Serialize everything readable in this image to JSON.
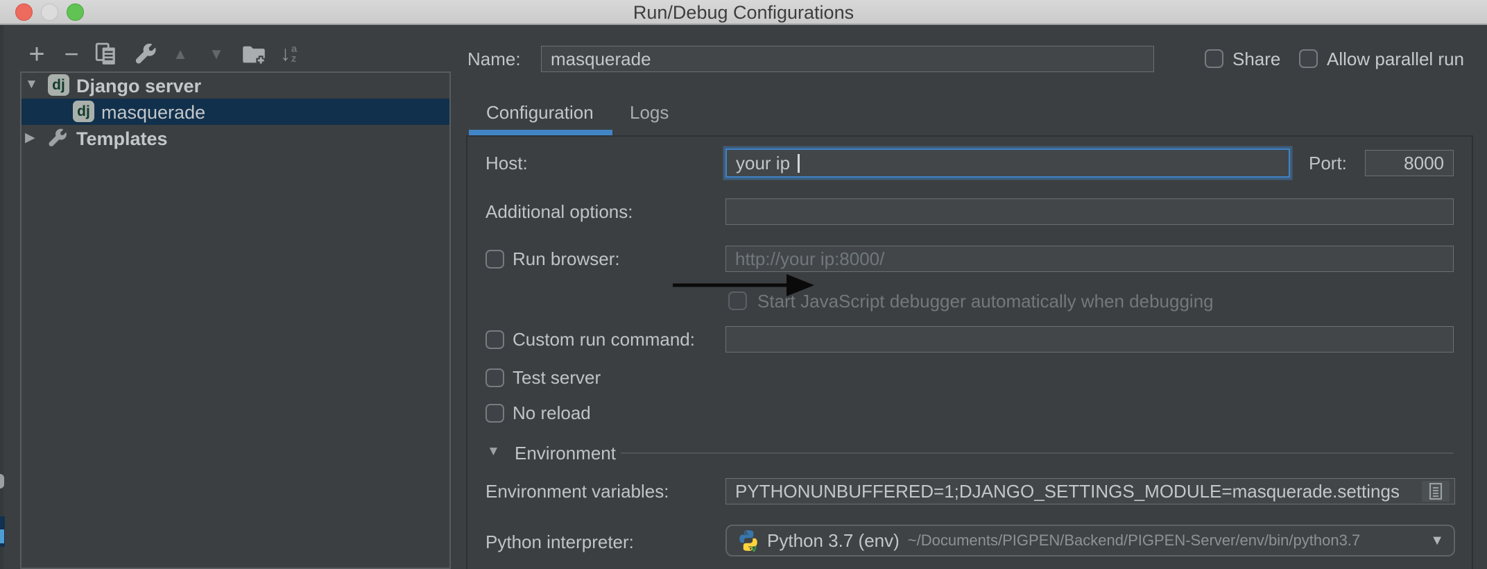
{
  "window": {
    "title": "Run/Debug Configurations"
  },
  "toolbar": {
    "icons": [
      "add",
      "remove",
      "copy",
      "edit-templates",
      "move-up",
      "move-down",
      "new-folder",
      "sort-configurations"
    ]
  },
  "sidebar": {
    "tree": [
      {
        "label": "Django server",
        "badge": "dj",
        "icon": "django-badge",
        "expanded": true,
        "selected": false
      },
      {
        "label": "masquerade",
        "badge": "dj",
        "icon": "django-badge",
        "expanded": false,
        "selected": true
      },
      {
        "label": "Templates",
        "badge": "",
        "icon": "wrench",
        "expanded": false,
        "selected": false
      }
    ]
  },
  "header": {
    "name_label": "Name:",
    "name_value": "masquerade",
    "share": {
      "label": "Share",
      "checked": false
    },
    "allow_parallel": {
      "label": "Allow parallel run",
      "checked": false
    }
  },
  "tabs": {
    "items": [
      {
        "label": "Configuration",
        "active": true
      },
      {
        "label": "Logs",
        "active": false
      }
    ]
  },
  "form": {
    "host": {
      "label": "Host:",
      "value": "your ip",
      "focused": true
    },
    "port": {
      "label": "Port:",
      "value": "8000"
    },
    "additional_options": {
      "label": "Additional options:",
      "value": ""
    },
    "run_browser": {
      "label": "Run browser:",
      "checked": false,
      "placeholder": "http://your ip:8000/"
    },
    "js_debugger": {
      "label": "Start JavaScript debugger automatically when debugging",
      "checked": false,
      "disabled": true
    },
    "custom_run": {
      "label": "Custom run command:",
      "checked": false,
      "value": ""
    },
    "test_server": {
      "label": "Test server",
      "checked": false
    },
    "no_reload": {
      "label": "No reload",
      "checked": false
    },
    "environment_section": {
      "label": "Environment",
      "expanded": true
    },
    "env_vars": {
      "label": "Environment variables:",
      "value": "PYTHONUNBUFFERED=1;DJANGO_SETTINGS_MODULE=masquerade.settings",
      "icon": "browse-variables"
    },
    "python_interpreter": {
      "label": "Python interpreter:",
      "value": "Python 3.7 (env)",
      "path": "~/Documents/PIGPEN/Backend/PIGPEN-Server/env/bin/python3.7",
      "icon": "python-logo"
    }
  },
  "annotation": {
    "type": "black-arrow-right"
  },
  "colors": {
    "titlebar_top": "#d8d8d8",
    "titlebar_bottom": "#cbcbcb",
    "titlebar_border": "#9fa0a1",
    "titlebar_text": "#3d3d3d",
    "tl_red": "#ed6a5f",
    "tl_mid": "#dcdcdc",
    "tl_green": "#61c354",
    "panel_border": "#585c5e",
    "content_border": "#2e3133",
    "field_bg": "#424649",
    "field_border": "#6b7073",
    "accent": "#4285c6",
    "focus": "#3f82c5",
    "selection": "#11304c",
    "text": "#c3c7c9",
    "label": "#c0c4c6",
    "dim": "#8d9294",
    "disabled": "#73787a",
    "placeholder": "#70787c",
    "icon": "#a9adaf",
    "icon_disabled": "#63676a",
    "dj_bg": "#a9b0ab",
    "dj_text": "#123b2b",
    "py_blue": "#3776ab",
    "py_yellow": "#ffd43b",
    "py_green": "#3fa142",
    "arrow": "#0a0a0a",
    "caret": "#d2d6d8",
    "checkbox_border": "#767c7f",
    "hline": "#515456"
  }
}
